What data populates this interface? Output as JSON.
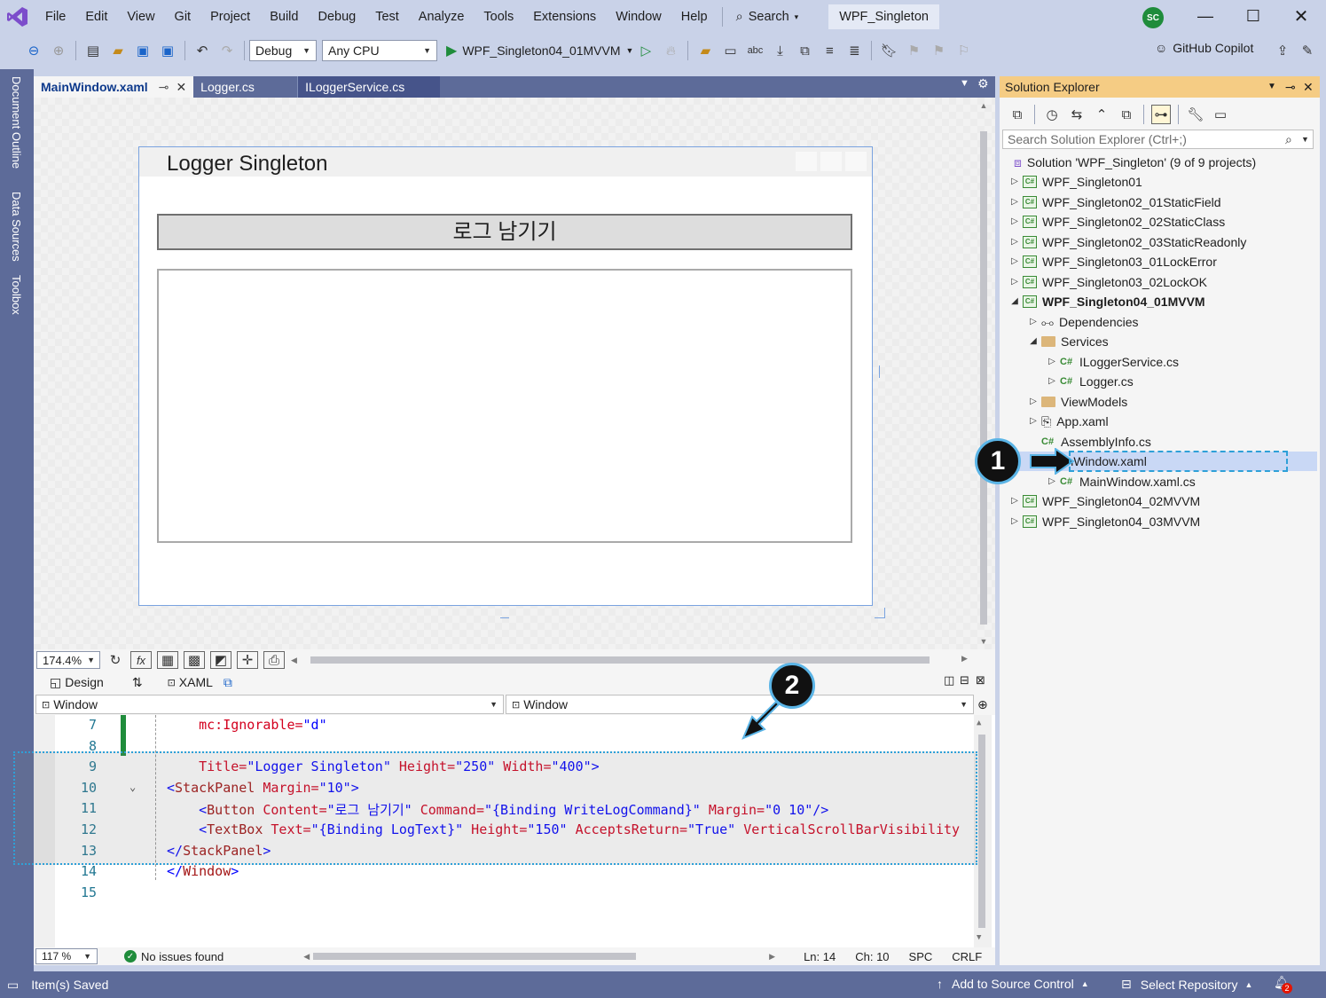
{
  "menu": {
    "items": [
      "File",
      "Edit",
      "View",
      "Git",
      "Project",
      "Build",
      "Debug",
      "Test",
      "Analyze",
      "Tools",
      "Extensions",
      "Window",
      "Help"
    ],
    "search_label": "Search",
    "solution_name": "WPF_Singleton",
    "avatar_initials": "SC"
  },
  "toolbar": {
    "config": "Debug",
    "platform": "Any CPU",
    "start_target": "WPF_Singleton04_01MVVM",
    "copilot_label": "GitHub Copilot"
  },
  "side_tabs": [
    "Document Outline",
    "Data Sources",
    "Toolbox"
  ],
  "doc_tabs": [
    {
      "label": "MainWindow.xaml",
      "active": true
    },
    {
      "label": "Logger.cs",
      "active": false
    },
    {
      "label": "ILoggerService.cs",
      "active": false
    }
  ],
  "designer": {
    "window_title": "Logger Singleton",
    "button_label": "로그 남기기",
    "zoom": "174.4%",
    "fx_label": "fx"
  },
  "split": {
    "design_label": "Design",
    "xaml_label": "XAML",
    "nav_left": "Window",
    "nav_right": "Window"
  },
  "code_lines": [
    {
      "n": "7",
      "segments": [
        {
          "t": "    mc:Ignorable=",
          "c": "t-attr"
        },
        {
          "t": "\"d\"",
          "c": "t-val"
        }
      ]
    },
    {
      "n": "8",
      "segments": []
    },
    {
      "n": "9",
      "segments": [
        {
          "t": "    Title=",
          "c": "t-attr"
        },
        {
          "t": "\"Logger Singleton\"",
          "c": "t-val"
        },
        {
          "t": " Height=",
          "c": "t-attr"
        },
        {
          "t": "\"250\"",
          "c": "t-val"
        },
        {
          "t": " Width=",
          "c": "t-attr"
        },
        {
          "t": "\"400\"",
          "c": "t-val"
        },
        {
          "t": ">",
          "c": "t-br"
        }
      ]
    },
    {
      "n": "10",
      "segments": [
        {
          "t": "<",
          "c": "t-br"
        },
        {
          "t": "StackPanel",
          "c": "t-tag"
        },
        {
          "t": " Margin=",
          "c": "t-attr"
        },
        {
          "t": "\"10\"",
          "c": "t-val"
        },
        {
          "t": ">",
          "c": "t-br"
        }
      ]
    },
    {
      "n": "11",
      "segments": [
        {
          "t": "    <",
          "c": "t-br"
        },
        {
          "t": "Button",
          "c": "t-tag"
        },
        {
          "t": " Content=",
          "c": "t-attr"
        },
        {
          "t": "\"로그 남기기\"",
          "c": "t-val"
        },
        {
          "t": " Command=",
          "c": "t-attr"
        },
        {
          "t": "\"{Binding WriteLogCommand}\"",
          "c": "t-val"
        },
        {
          "t": " Margin=",
          "c": "t-attr"
        },
        {
          "t": "\"0 10\"",
          "c": "t-val"
        },
        {
          "t": "/>",
          "c": "t-br"
        }
      ]
    },
    {
      "n": "12",
      "segments": [
        {
          "t": "    <",
          "c": "t-br"
        },
        {
          "t": "TextBox",
          "c": "t-tag"
        },
        {
          "t": " Text=",
          "c": "t-attr"
        },
        {
          "t": "\"{Binding LogText}\"",
          "c": "t-val"
        },
        {
          "t": " Height=",
          "c": "t-attr"
        },
        {
          "t": "\"150\"",
          "c": "t-val"
        },
        {
          "t": " AcceptsReturn=",
          "c": "t-attr"
        },
        {
          "t": "\"True\"",
          "c": "t-val"
        },
        {
          "t": " VerticalScrollBarVisibility",
          "c": "t-attr"
        }
      ]
    },
    {
      "n": "13",
      "segments": [
        {
          "t": "</",
          "c": "t-br"
        },
        {
          "t": "StackPanel",
          "c": "t-tag"
        },
        {
          "t": ">",
          "c": "t-br"
        }
      ]
    },
    {
      "n": "14",
      "segments": [
        {
          "t": "</",
          "c": "t-br"
        },
        {
          "t": "Window",
          "c": "t-tag"
        },
        {
          "t": ">",
          "c": "t-br"
        }
      ]
    },
    {
      "n": "15",
      "segments": []
    }
  ],
  "editor_status": {
    "zoom": "117 %",
    "issues": "No issues found",
    "ln": "Ln: 14",
    "ch": "Ch: 10",
    "spc": "SPC",
    "crlf": "CRLF"
  },
  "solution_explorer": {
    "title": "Solution Explorer",
    "search_placeholder": "Search Solution Explorer (Ctrl+;)",
    "solution_label": "Solution 'WPF_Singleton' (9 of 9 projects)",
    "tree": [
      {
        "label": "WPF_Singleton01",
        "kind": "proj",
        "exp": "▷"
      },
      {
        "label": "WPF_Singleton02_01StaticField",
        "kind": "proj",
        "exp": "▷"
      },
      {
        "label": "WPF_Singleton02_02StaticClass",
        "kind": "proj",
        "exp": "▷"
      },
      {
        "label": "WPF_Singleton02_03StaticReadonly",
        "kind": "proj",
        "exp": "▷"
      },
      {
        "label": "WPF_Singleton03_01LockError",
        "kind": "proj",
        "exp": "▷"
      },
      {
        "label": "WPF_Singleton03_02LockOK",
        "kind": "proj",
        "exp": "▷"
      },
      {
        "label": "WPF_Singleton04_01MVVM",
        "kind": "proj",
        "exp": "◢",
        "bold": true
      },
      {
        "label": "Dependencies",
        "kind": "deps",
        "exp": "▷",
        "level": 1
      },
      {
        "label": "Services",
        "kind": "folder",
        "exp": "◢",
        "level": 1
      },
      {
        "label": "ILoggerService.cs",
        "kind": "cs",
        "exp": "▷",
        "level": 2
      },
      {
        "label": "Logger.cs",
        "kind": "cs",
        "exp": "▷",
        "level": 2
      },
      {
        "label": "ViewModels",
        "kind": "folder",
        "exp": "▷",
        "level": 1
      },
      {
        "label": "App.xaml",
        "kind": "xaml",
        "exp": "▷",
        "level": 1
      },
      {
        "label": "AssemblyInfo.cs",
        "kind": "cs",
        "exp": "",
        "level": 1
      },
      {
        "label": "MainWindow.xaml",
        "kind": "none",
        "exp": "",
        "level": 1,
        "selected": true
      },
      {
        "label": "MainWindow.xaml.cs",
        "kind": "cs",
        "exp": "▷",
        "level": 2
      },
      {
        "label": "WPF_Singleton04_02MVVM",
        "kind": "proj",
        "exp": "▷"
      },
      {
        "label": "WPF_Singleton04_03MVVM",
        "kind": "proj",
        "exp": "▷"
      }
    ]
  },
  "statusbar": {
    "left": "Item(s) Saved",
    "source_control": "Add to Source Control",
    "repo": "Select Repository",
    "notifications": "2"
  },
  "callouts": [
    "1",
    "2"
  ],
  "colors": {
    "accent": "#5d6b99",
    "selection": "#c9d8f5",
    "callout_border": "#5ab4e6",
    "panel_title": "#f5cc84"
  }
}
